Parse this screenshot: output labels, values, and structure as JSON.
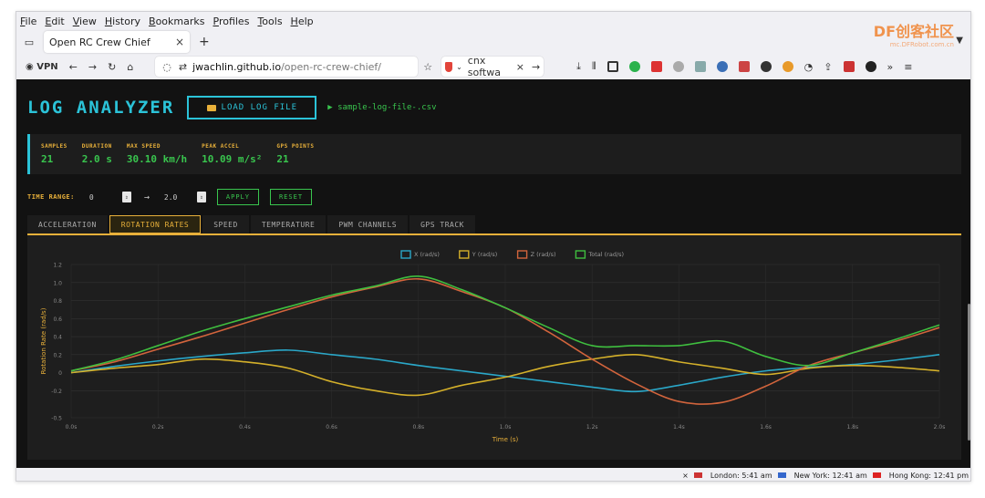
{
  "browser": {
    "menu": [
      "File",
      "Edit",
      "View",
      "History",
      "Bookmarks",
      "Profiles",
      "Tools",
      "Help"
    ],
    "tab_title": "Open RC Crew Chief",
    "tab_close": "×",
    "new_tab": "+",
    "vpn": "VPN",
    "url_host": "jwachlin.github.io",
    "url_path": "/open-rc-crew-chief/",
    "search_text": "cnx softwa",
    "search_clear": "×",
    "search_go": "→"
  },
  "watermark": {
    "main": "DF创客社区",
    "sub": "mc.DFRobot.com.cn"
  },
  "app": {
    "title": "LOG ANALYZER",
    "load_button": "LOAD LOG FILE",
    "file_name": "▶ sample-log-file-.csv",
    "stats": [
      {
        "label": "SAMPLES",
        "value": "21"
      },
      {
        "label": "DURATION",
        "value": "2.0 s"
      },
      {
        "label": "MAX SPEED",
        "value": "30.10 km/h"
      },
      {
        "label": "PEAK ACCEL",
        "value": "10.09 m/s²"
      },
      {
        "label": "GPS POINTS",
        "value": "21"
      }
    ],
    "time_range": {
      "label": "TIME RANGE:",
      "start": "0",
      "arrow": "→",
      "end": "2.0",
      "apply": "APPLY",
      "reset": "RESET"
    },
    "tabs": [
      {
        "label": "ACCELERATION",
        "active": false
      },
      {
        "label": "ROTATION RATES",
        "active": true
      },
      {
        "label": "SPEED",
        "active": false
      },
      {
        "label": "TEMPERATURE",
        "active": false
      },
      {
        "label": "PWM CHANNELS",
        "active": false
      },
      {
        "label": "GPS TRACK",
        "active": false
      }
    ]
  },
  "statusbar": {
    "close": "×",
    "london": "London: 5:41 am",
    "newyork": "New York: 12:41 am",
    "hongkong": "Hong Kong: 12:41 pm"
  },
  "chart_data": {
    "type": "line",
    "xlabel": "Time (s)",
    "ylabel": "Rotation Rate (rad/s)",
    "xlim": [
      0,
      2.0
    ],
    "ylim": [
      -0.5,
      1.2
    ],
    "x_ticks": [
      "0.0s",
      "0.2s",
      "0.4s",
      "0.6s",
      "0.8s",
      "1.0s",
      "1.2s",
      "1.4s",
      "1.6s",
      "1.8s",
      "2.0s"
    ],
    "y_ticks": [
      "1.2",
      "1.0",
      "0.8",
      "0.6",
      "0.4",
      "0.2",
      "0",
      "-0.2",
      "-0.5"
    ],
    "grid": true,
    "legend_position": "top-center",
    "x": [
      0,
      0.1,
      0.2,
      0.3,
      0.4,
      0.5,
      0.6,
      0.7,
      0.8,
      0.9,
      1.0,
      1.1,
      1.2,
      1.3,
      1.4,
      1.5,
      1.6,
      1.7,
      1.8,
      1.9,
      2.0
    ],
    "series": [
      {
        "name": "X (rad/s)",
        "color": "#2aa7c8",
        "values": [
          0.0,
          0.07,
          0.13,
          0.18,
          0.22,
          0.25,
          0.2,
          0.15,
          0.08,
          0.02,
          -0.04,
          -0.1,
          -0.16,
          -0.21,
          -0.14,
          -0.05,
          0.02,
          0.06,
          0.09,
          0.14,
          0.2
        ]
      },
      {
        "name": "Y (rad/s)",
        "color": "#d4b02a",
        "values": [
          0.0,
          0.05,
          0.09,
          0.15,
          0.12,
          0.05,
          -0.1,
          -0.2,
          -0.25,
          -0.14,
          -0.05,
          0.07,
          0.15,
          0.2,
          0.12,
          0.05,
          -0.02,
          0.05,
          0.08,
          0.06,
          0.02
        ]
      },
      {
        "name": "Z (rad/s)",
        "color": "#d2643c",
        "values": [
          0.02,
          0.12,
          0.26,
          0.4,
          0.55,
          0.7,
          0.84,
          0.95,
          1.04,
          0.9,
          0.72,
          0.45,
          0.15,
          -0.12,
          -0.32,
          -0.33,
          -0.15,
          0.08,
          0.22,
          0.35,
          0.5
        ]
      },
      {
        "name": "Total (rad/s)",
        "color": "#3fbf3f",
        "values": [
          0.02,
          0.14,
          0.3,
          0.46,
          0.6,
          0.73,
          0.86,
          0.96,
          1.07,
          0.92,
          0.72,
          0.5,
          0.3,
          0.3,
          0.3,
          0.35,
          0.18,
          0.08,
          0.22,
          0.37,
          0.53
        ]
      }
    ]
  }
}
